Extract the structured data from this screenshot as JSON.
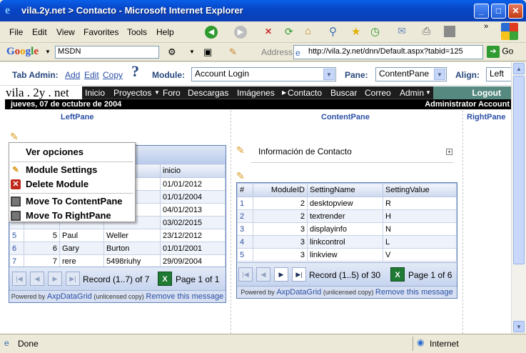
{
  "window": {
    "title": "vila.2y.net > Contacto - Microsoft Internet Explorer"
  },
  "menu": [
    "File",
    "Edit",
    "View",
    "Favorites",
    "Tools",
    "Help"
  ],
  "google": {
    "label": "Google",
    "search_value": "MSDN"
  },
  "address": {
    "label": "Address",
    "url": "http://vila.2y.net/dnn/Default.aspx?tabid=125",
    "go": "Go"
  },
  "admin": {
    "tab_admin_label": "Tab Admin:",
    "add": "Add",
    "edit": "Edit",
    "copy": "Copy",
    "module_label": "Module:",
    "module_value": "Account Login",
    "pane_label": "Pane:",
    "pane_value": "ContentPane",
    "align_label": "Align:",
    "align_value": "Left"
  },
  "site": {
    "brand": "vila . 2y . net",
    "nav": [
      "Inicio",
      "Proyectos",
      "Foro",
      "Descargas",
      "Imágenes",
      "Contacto",
      "Buscar",
      "Correo",
      "Admin"
    ],
    "logout": "Logout",
    "date": "jueves, 07 de octubre de 2004",
    "account": "Administrator Account"
  },
  "panes": {
    "left": "LeftPane",
    "content": "ContentPane",
    "right": "RightPane"
  },
  "context_menu": {
    "items": [
      {
        "label": "Ver opciones",
        "icon": "none"
      },
      {
        "label": "Module Settings",
        "icon": "pencil-icon"
      },
      {
        "label": "Delete Module",
        "icon": "delete-icon"
      },
      {
        "label": "Move To ContentPane",
        "icon": "move-icon"
      },
      {
        "label": "Move To RightPane",
        "icon": "move-icon"
      }
    ]
  },
  "left_grid": {
    "header_visible": "inicio",
    "rows": [
      {
        "idx": "",
        "id": "",
        "first": "",
        "last": "",
        "inicio": "01/01/2012"
      },
      {
        "idx": "",
        "id": "",
        "first": "",
        "last": "",
        "inicio": "01/01/2004"
      },
      {
        "idx": "",
        "id": "",
        "first": "",
        "last": "",
        "inicio": "04/01/2013"
      },
      {
        "idx": "",
        "id": "",
        "first": "",
        "last": "",
        "inicio": "03/02/2015"
      },
      {
        "idx": "5",
        "id": "5",
        "first": "Paul",
        "last": "Weller",
        "inicio": "23/12/2012"
      },
      {
        "idx": "6",
        "id": "6",
        "first": "Gary",
        "last": "Burton",
        "inicio": "01/01/2001"
      },
      {
        "idx": "7",
        "id": "7",
        "first": "rere",
        "last": "5498riuhy",
        "inicio": "29/09/2004"
      }
    ],
    "record": "Record (1..7) of 7",
    "page": "Page 1 of 1",
    "powered_prefix": "Powered by",
    "powered_brand": "AxpDataGrid",
    "powered_note": "(unlicensed copy)",
    "remove": "Remove this message"
  },
  "contact": {
    "title": "Información de Contacto"
  },
  "settings_grid": {
    "headers": [
      "#",
      "ModuleID",
      "SettingName",
      "SettingValue"
    ],
    "rows": [
      {
        "n": "1",
        "mid": "2",
        "name": "desktopview",
        "value": "R"
      },
      {
        "n": "2",
        "mid": "2",
        "name": "textrender",
        "value": "H"
      },
      {
        "n": "3",
        "mid": "3",
        "name": "displayinfo",
        "value": "N"
      },
      {
        "n": "4",
        "mid": "3",
        "name": "linkcontrol",
        "value": "L"
      },
      {
        "n": "5",
        "mid": "3",
        "name": "linkview",
        "value": "V"
      }
    ],
    "record": "Record (1..5) of 30",
    "page": "Page 1 of 6",
    "powered_prefix": "Powered by",
    "powered_brand": "AxpDataGrid",
    "powered_note": "(unlicensed copy)",
    "remove": "Remove this message"
  },
  "status": {
    "left": "Done",
    "zone": "Internet"
  }
}
